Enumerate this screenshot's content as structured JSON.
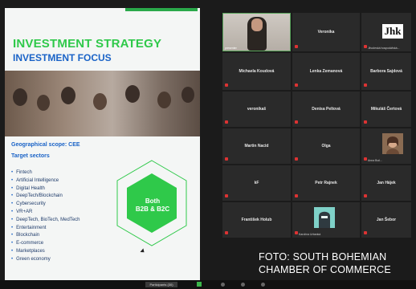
{
  "slide": {
    "title": "INVESTMENT STRATEGY",
    "subtitle": "INVESTMENT FOCUS",
    "geographical_scope": "Geographical scope: CEE",
    "target_sectors_title": "Target sectors",
    "sectors": [
      "Fintech",
      "Artificial Intelligence",
      "Digital Health",
      "DeepTech/Blockchain",
      "Cybersecurity",
      "VR+AR",
      "DeepTech, BioTech, MedTech",
      "Entertainment",
      "Blockchain",
      "E-commerce",
      "Marketplaces",
      "Green economy"
    ],
    "hexagon_line1": "Both",
    "hexagon_line2": "B2B & B2C",
    "accent_green": "#2fc94a",
    "accent_blue": "#1a63c7"
  },
  "participants": {
    "video_label": "presenter",
    "tiles": [
      {
        "name": "Veronika"
      },
      {
        "name": "Michaela Koudová"
      },
      {
        "name": "Lenka Zemanová"
      },
      {
        "name": "Barbora Sajdová"
      },
      {
        "name": "veronikaš"
      },
      {
        "name": "Denisa Peltová"
      },
      {
        "name": "Mikuláš Čertová"
      },
      {
        "name": "Martin Nacid"
      },
      {
        "name": "Olga"
      },
      {
        "name": "kF"
      },
      {
        "name": "Petr Rajnek"
      },
      {
        "name": "Jan Hájek"
      },
      {
        "name": "František Holub"
      },
      {
        "name": "Jan Šebor"
      }
    ],
    "logo_text": "Jhk",
    "logo_tile_label": "Jihočeská hospodářská...",
    "photo_tile_label": "Anna Boč...",
    "avatar_tile_label": "Karolína Urbanká"
  },
  "caption": {
    "line1": "FOTO: SOUTH BOHEMIAN",
    "line2": "CHAMBER OF COMMERCE"
  },
  "bottombar": {
    "participants_label": "Participants (30)"
  }
}
